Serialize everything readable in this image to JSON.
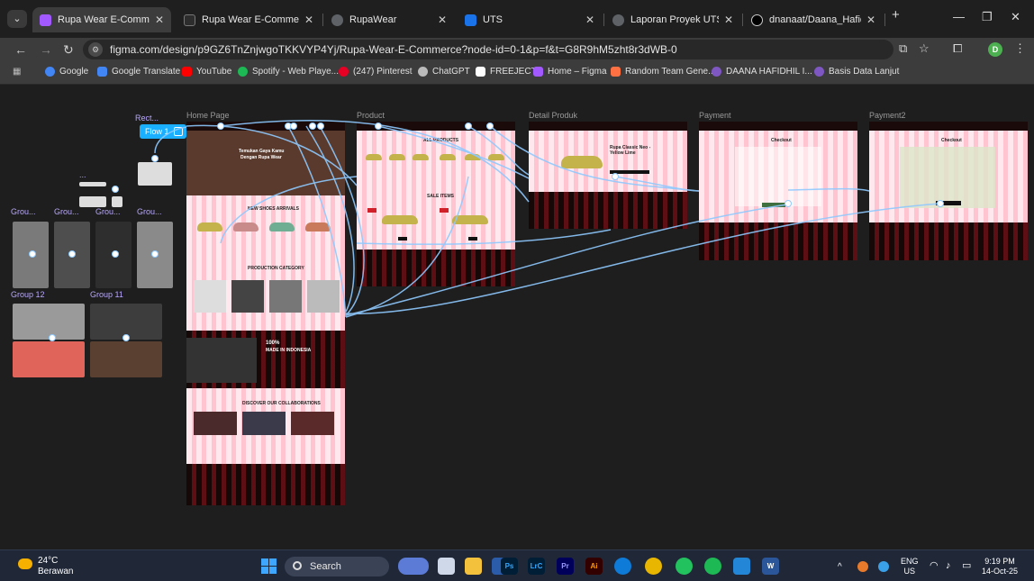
{
  "browser": {
    "tabs": [
      {
        "label": "Rupa Wear E-Commerce –",
        "icon": "figma-icon",
        "color": "#a259ff",
        "active": true
      },
      {
        "label": "Rupa Wear E-Commerce",
        "icon": "figma-icon",
        "color": "#2d2d2d",
        "active": false
      },
      {
        "label": "RupaWear",
        "icon": "globe-icon",
        "color": "#5f6368",
        "active": false
      },
      {
        "label": "UTS",
        "icon": "document-icon",
        "color": "#1a73e8",
        "active": false
      },
      {
        "label": "Laporan Proyek UTS.docx",
        "icon": "globe-icon",
        "color": "#5f6368",
        "active": false
      },
      {
        "label": "dnanaat/Daana_Hafidhil_I",
        "icon": "github-icon",
        "color": "#000000",
        "active": false
      }
    ],
    "tab_close": "✕",
    "new_tab": "+",
    "url": "figma.com/design/p9GZ6TnZnjwgoTKKVYP4Yj/Rupa-Wear-E-Commerce?node-id=0-1&p=f&t=G8R9hM5zht8r3dWB-0",
    "profile_initial": "D"
  },
  "bookmarks": [
    {
      "label": "Google",
      "color": "#4285f4"
    },
    {
      "label": "Google Translate",
      "color": "#4285f4"
    },
    {
      "label": "YouTube",
      "color": "#ff0000"
    },
    {
      "label": "Spotify - Web Playe...",
      "color": "#1db954"
    },
    {
      "label": "(247) Pinterest",
      "color": "#e60023"
    },
    {
      "label": "ChatGPT",
      "color": "#bbbbbb"
    },
    {
      "label": "FREEJECT",
      "color": "#ffffff"
    },
    {
      "label": "Home – Figma",
      "color": "#a259ff"
    },
    {
      "label": "Random Team Gene...",
      "color": "#ff7043"
    },
    {
      "label": "DAANA HAFIDHIL I...",
      "color": "#7e57c2"
    },
    {
      "label": "Basis Data Lanjut",
      "color": "#7e57c2"
    }
  ],
  "canvas": {
    "frames": [
      {
        "label": "Home Page"
      },
      {
        "label": "Product"
      },
      {
        "label": "Detail Produk"
      },
      {
        "label": "Payment"
      },
      {
        "label": "Payment2"
      }
    ],
    "flow_label": "Flow 1",
    "component_labels": [
      "Rect...",
      "...",
      "Grou...",
      "Grou...",
      "Grou...",
      "Grou...",
      "Group 12",
      "Group 11"
    ],
    "home": {
      "hero_line1": "Temukan Gaya Kamu",
      "hero_line2": "Dengan Rupa Wear",
      "section_arrivals": "NEW SHOES ARRIVALS",
      "section_category": "PRODUCTION CATEGORY",
      "made_big": "100%",
      "made_small": "MADE IN INDONESIA",
      "section_collab": "DISCOVER OUR COLLABORATIONS"
    },
    "product": {
      "title": "ALL PRODUCTS",
      "sale": "SALE ITEMS"
    },
    "detail": {
      "title_line1": "Rupa Classic Neo -",
      "title_line2": "Yellow Lime"
    },
    "payment": {
      "title": "Checkout"
    },
    "payment2": {
      "title": "Checkout"
    }
  },
  "taskbar": {
    "weather_temp": "24°C",
    "weather_desc": "Berawan",
    "search_label": "Search",
    "lang_line1": "ENG",
    "lang_line2": "US",
    "time": "9:19 PM",
    "date": "14-Oct-25"
  }
}
